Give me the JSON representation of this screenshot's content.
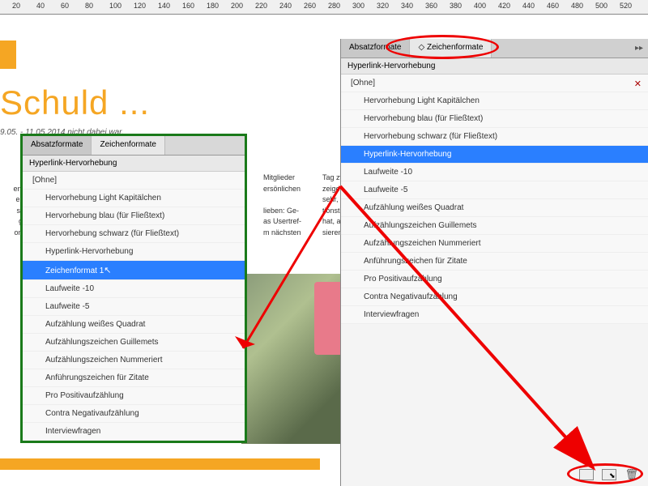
{
  "ruler_marks": [
    "20",
    "40",
    "60",
    "80",
    "100",
    "120",
    "140",
    "160",
    "180",
    "200",
    "220",
    "240",
    "260",
    "280",
    "300",
    "320",
    "340",
    "360",
    "380",
    "400",
    "420",
    "440",
    "460",
    "480",
    "500",
    "520"
  ],
  "document": {
    "heading": "Schuld ...",
    "subhead": "9.05. - 11.05.2014 nicht dabei war.",
    "body_left": "in g\nen Be\nei. W\nsehe\ngest\non au",
    "body_mid": "Mitglieder\nersönlichen\n\nlieben: Ge-\nas Usertref-\nm nächsten",
    "body_right": "Tag zw\nzeigen\nsehr, o\ntionste\nhat, au\nsieren."
  },
  "panels": {
    "tab_absatz": "Absatzformate",
    "tab_zeichen": "Zeichenformate",
    "status": "Hyperlink-Hervorhebung"
  },
  "styles_left": [
    {
      "label": "[Ohne]",
      "indent": 0
    },
    {
      "label": "Hervorhebung Light Kapitälchen",
      "indent": 1
    },
    {
      "label": "Hervorhebung blau (für Fließtext)",
      "indent": 1
    },
    {
      "label": "Hervorhebung schwarz (für Fließtext)",
      "indent": 1
    },
    {
      "label": "Hyperlink-Hervorhebung",
      "indent": 1
    },
    {
      "label": "Zeichenformat 1",
      "indent": 1,
      "selected": true
    },
    {
      "label": "Laufweite -10",
      "indent": 1
    },
    {
      "label": "Laufweite -5",
      "indent": 1
    },
    {
      "label": "Aufzählung weißes Quadrat",
      "indent": 1
    },
    {
      "label": "Aufzählungszeichen Guillemets",
      "indent": 1
    },
    {
      "label": "Aufzählungszeichen Nummeriert",
      "indent": 1
    },
    {
      "label": "Anführungszeichen für Zitate",
      "indent": 1
    },
    {
      "label": "Pro Positivaufzählung",
      "indent": 1
    },
    {
      "label": "Contra Negativaufzählung",
      "indent": 1
    },
    {
      "label": "Interviewfragen",
      "indent": 1
    }
  ],
  "styles_right": [
    {
      "label": "[Ohne]",
      "indent": 0,
      "xmark": true
    },
    {
      "label": "Hervorhebung Light Kapitälchen",
      "indent": 1
    },
    {
      "label": "Hervorhebung blau (für Fließtext)",
      "indent": 1
    },
    {
      "label": "Hervorhebung schwarz (für Fließtext)",
      "indent": 1
    },
    {
      "label": "Hyperlink-Hervorhebung",
      "indent": 1,
      "selected": true
    },
    {
      "label": "Laufweite -10",
      "indent": 1
    },
    {
      "label": "Laufweite -5",
      "indent": 1
    },
    {
      "label": "Aufzählung weißes Quadrat",
      "indent": 1
    },
    {
      "label": "Aufzählungszeichen Guillemets",
      "indent": 1
    },
    {
      "label": "Aufzählungszeichen Nummeriert",
      "indent": 1
    },
    {
      "label": "Anführungszeichen für Zitate",
      "indent": 1
    },
    {
      "label": "Pro Positivaufzählung",
      "indent": 1
    },
    {
      "label": "Contra Negativaufzählung",
      "indent": 1
    },
    {
      "label": "Interviewfragen",
      "indent": 1
    }
  ]
}
